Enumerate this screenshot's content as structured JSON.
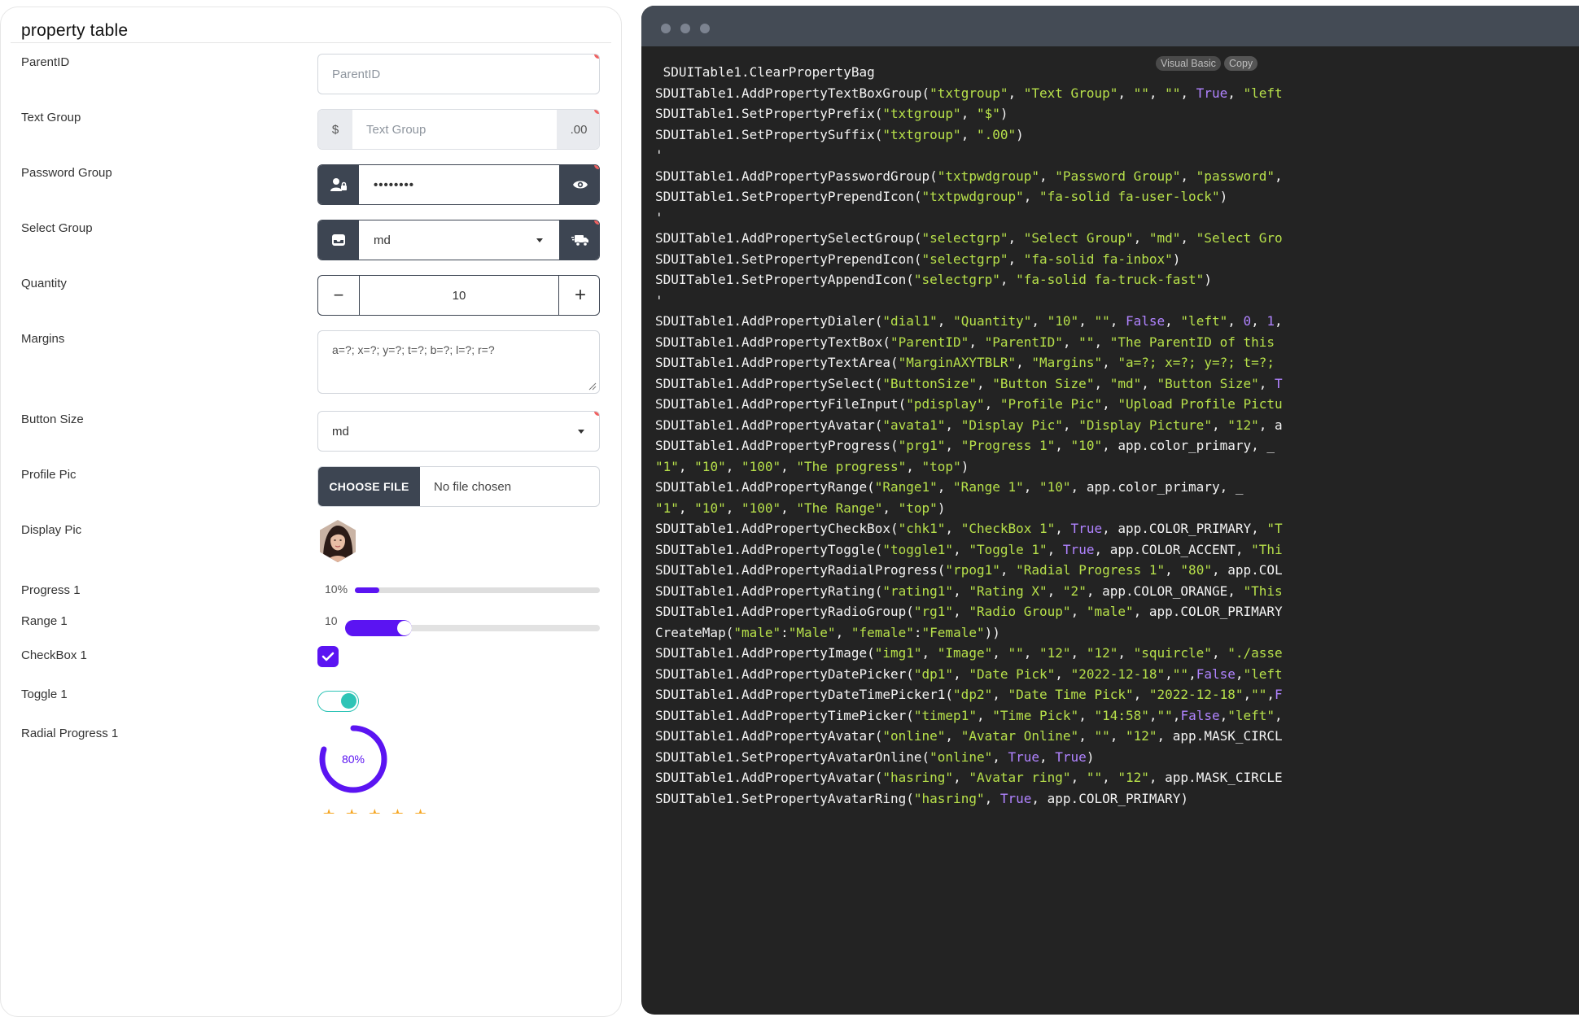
{
  "title": "property table",
  "fields": {
    "parentid": {
      "label": "ParentID",
      "placeholder": "ParentID"
    },
    "text_group": {
      "label": "Text Group",
      "prefix": "$",
      "placeholder": "Text Group",
      "suffix": ".00"
    },
    "password_group": {
      "label": "Password Group",
      "value": "••••••••",
      "prepend_icon": "user-lock-icon",
      "append_icon": "eye-icon"
    },
    "select_group": {
      "label": "Select Group",
      "value": "md",
      "prepend_icon": "inbox-icon",
      "append_icon": "truck-fast-icon"
    },
    "quantity": {
      "label": "Quantity",
      "value": "10",
      "minus": "−",
      "plus": "+"
    },
    "margins": {
      "label": "Margins",
      "value": "a=?; x=?; y=?; t=?; b=?; l=?; r=?"
    },
    "button_size": {
      "label": "Button Size",
      "value": "md"
    },
    "profile_pic": {
      "label": "Profile Pic",
      "button": "CHOOSE FILE",
      "status": "No file chosen"
    },
    "display_pic": {
      "label": "Display Pic",
      "avatar": "avatar-icon"
    },
    "progress": {
      "label": "Progress 1",
      "percent_text": "10%",
      "value": 10
    },
    "range": {
      "label": "Range 1",
      "value_text": "10",
      "value": 10,
      "min": 1,
      "max": 100
    },
    "checkbox": {
      "label": "CheckBox 1",
      "checked": true
    },
    "toggle": {
      "label": "Toggle 1",
      "on": true
    },
    "radial": {
      "label": "Radial Progress 1",
      "text": "80%",
      "value": 80
    }
  },
  "colors": {
    "primary": "#5b14f2",
    "accent": "#2ec4b6",
    "required_dot": "#ef6161",
    "dark_addon": "#3d4552",
    "star": "#f5a623"
  },
  "code_panel": {
    "language": "Visual Basic",
    "copy": "Copy",
    "lines": [
      [
        {
          "t": " SDUITable1.ClearPropertyBag"
        }
      ],
      [
        {
          "t": "SDUITable1.AddPropertyTextBoxGroup("
        },
        {
          "t": "\"txtgroup\"",
          "c": "s"
        },
        {
          "t": ", "
        },
        {
          "t": "\"Text Group\"",
          "c": "s"
        },
        {
          "t": ", "
        },
        {
          "t": "\"\"",
          "c": "s"
        },
        {
          "t": ", "
        },
        {
          "t": "\"\"",
          "c": "s"
        },
        {
          "t": ", "
        },
        {
          "t": "True",
          "c": "k"
        },
        {
          "t": ", "
        },
        {
          "t": "\"left",
          "c": "s"
        }
      ],
      [
        {
          "t": "SDUITable1.SetPropertyPrefix("
        },
        {
          "t": "\"txtgroup\"",
          "c": "s"
        },
        {
          "t": ", "
        },
        {
          "t": "\"$\"",
          "c": "s"
        },
        {
          "t": ")"
        }
      ],
      [
        {
          "t": "SDUITable1.SetPropertySuffix("
        },
        {
          "t": "\"txtgroup\"",
          "c": "s"
        },
        {
          "t": ", "
        },
        {
          "t": "\".00\"",
          "c": "s"
        },
        {
          "t": ")"
        }
      ],
      [
        {
          "t": "'"
        }
      ],
      [
        {
          "t": "SDUITable1.AddPropertyPasswordGroup("
        },
        {
          "t": "\"txtpwdgroup\"",
          "c": "s"
        },
        {
          "t": ", "
        },
        {
          "t": "\"Password Group\"",
          "c": "s"
        },
        {
          "t": ", "
        },
        {
          "t": "\"password\"",
          "c": "s"
        },
        {
          "t": ","
        }
      ],
      [
        {
          "t": "SDUITable1.SetPropertyPrependIcon("
        },
        {
          "t": "\"txtpwdgroup\"",
          "c": "s"
        },
        {
          "t": ", "
        },
        {
          "t": "\"fa-solid fa-user-lock\"",
          "c": "s"
        },
        {
          "t": ")"
        }
      ],
      [
        {
          "t": "'"
        }
      ],
      [
        {
          "t": "SDUITable1.AddPropertySelectGroup("
        },
        {
          "t": "\"selectgrp\"",
          "c": "s"
        },
        {
          "t": ", "
        },
        {
          "t": "\"Select Group\"",
          "c": "s"
        },
        {
          "t": ", "
        },
        {
          "t": "\"md\"",
          "c": "s"
        },
        {
          "t": ", "
        },
        {
          "t": "\"Select Gro",
          "c": "s"
        }
      ],
      [
        {
          "t": "SDUITable1.SetPropertyPrependIcon("
        },
        {
          "t": "\"selectgrp\"",
          "c": "s"
        },
        {
          "t": ", "
        },
        {
          "t": "\"fa-solid fa-inbox\"",
          "c": "s"
        },
        {
          "t": ")"
        }
      ],
      [
        {
          "t": "SDUITable1.SetPropertyAppendIcon("
        },
        {
          "t": "\"selectgrp\"",
          "c": "s"
        },
        {
          "t": ", "
        },
        {
          "t": "\"fa-solid fa-truck-fast\"",
          "c": "s"
        },
        {
          "t": ")"
        }
      ],
      [
        {
          "t": "'"
        }
      ],
      [
        {
          "t": "SDUITable1.AddPropertyDialer("
        },
        {
          "t": "\"dial1\"",
          "c": "s"
        },
        {
          "t": ", "
        },
        {
          "t": "\"Quantity\"",
          "c": "s"
        },
        {
          "t": ", "
        },
        {
          "t": "\"10\"",
          "c": "s"
        },
        {
          "t": ", "
        },
        {
          "t": "\"\"",
          "c": "s"
        },
        {
          "t": ", "
        },
        {
          "t": "False",
          "c": "k"
        },
        {
          "t": ", "
        },
        {
          "t": "\"left\"",
          "c": "s"
        },
        {
          "t": ", "
        },
        {
          "t": "0",
          "c": "k"
        },
        {
          "t": ", "
        },
        {
          "t": "1",
          "c": "k"
        },
        {
          "t": ","
        }
      ],
      [
        {
          "t": "SDUITable1.AddPropertyTextBox("
        },
        {
          "t": "\"ParentID\"",
          "c": "s"
        },
        {
          "t": ", "
        },
        {
          "t": "\"ParentID\"",
          "c": "s"
        },
        {
          "t": ", "
        },
        {
          "t": "\"\"",
          "c": "s"
        },
        {
          "t": ", "
        },
        {
          "t": "\"The ParentID of this",
          "c": "s"
        }
      ],
      [
        {
          "t": "SDUITable1.AddPropertyTextArea("
        },
        {
          "t": "\"MarginAXYTBLR\"",
          "c": "s"
        },
        {
          "t": ", "
        },
        {
          "t": "\"Margins\"",
          "c": "s"
        },
        {
          "t": ", "
        },
        {
          "t": "\"a=?; x=?; y=?; t=?;",
          "c": "s"
        }
      ],
      [
        {
          "t": "SDUITable1.AddPropertySelect("
        },
        {
          "t": "\"ButtonSize\"",
          "c": "s"
        },
        {
          "t": ", "
        },
        {
          "t": "\"Button Size\"",
          "c": "s"
        },
        {
          "t": ", "
        },
        {
          "t": "\"md\"",
          "c": "s"
        },
        {
          "t": ", "
        },
        {
          "t": "\"Button Size\"",
          "c": "s"
        },
        {
          "t": ", "
        },
        {
          "t": "T",
          "c": "k"
        }
      ],
      [
        {
          "t": "SDUITable1.AddPropertyFileInput("
        },
        {
          "t": "\"pdisplay\"",
          "c": "s"
        },
        {
          "t": ", "
        },
        {
          "t": "\"Profile Pic\"",
          "c": "s"
        },
        {
          "t": ", "
        },
        {
          "t": "\"Upload Profile Pictu",
          "c": "s"
        }
      ],
      [
        {
          "t": "SDUITable1.AddPropertyAvatar("
        },
        {
          "t": "\"avata1\"",
          "c": "s"
        },
        {
          "t": ", "
        },
        {
          "t": "\"Display Pic\"",
          "c": "s"
        },
        {
          "t": ", "
        },
        {
          "t": "\"Display Picture\"",
          "c": "s"
        },
        {
          "t": ", "
        },
        {
          "t": "\"12\"",
          "c": "s"
        },
        {
          "t": ", a"
        }
      ],
      [
        {
          "t": "SDUITable1.AddPropertyProgress("
        },
        {
          "t": "\"prg1\"",
          "c": "s"
        },
        {
          "t": ", "
        },
        {
          "t": "\"Progress 1\"",
          "c": "s"
        },
        {
          "t": ", "
        },
        {
          "t": "\"10\"",
          "c": "s"
        },
        {
          "t": ", app.color_primary, _"
        }
      ],
      [
        {
          "t": "\"1\"",
          "c": "s"
        },
        {
          "t": ", "
        },
        {
          "t": "\"10\"",
          "c": "s"
        },
        {
          "t": ", "
        },
        {
          "t": "\"100\"",
          "c": "s"
        },
        {
          "t": ", "
        },
        {
          "t": "\"The progress\"",
          "c": "s"
        },
        {
          "t": ", "
        },
        {
          "t": "\"top\"",
          "c": "s"
        },
        {
          "t": ")"
        }
      ],
      [
        {
          "t": "SDUITable1.AddPropertyRange("
        },
        {
          "t": "\"Range1\"",
          "c": "s"
        },
        {
          "t": ", "
        },
        {
          "t": "\"Range 1\"",
          "c": "s"
        },
        {
          "t": ", "
        },
        {
          "t": "\"10\"",
          "c": "s"
        },
        {
          "t": ", app.color_primary, _"
        }
      ],
      [
        {
          "t": "\"1\"",
          "c": "s"
        },
        {
          "t": ", "
        },
        {
          "t": "\"10\"",
          "c": "s"
        },
        {
          "t": ", "
        },
        {
          "t": "\"100\"",
          "c": "s"
        },
        {
          "t": ", "
        },
        {
          "t": "\"The Range\"",
          "c": "s"
        },
        {
          "t": ", "
        },
        {
          "t": "\"top\"",
          "c": "s"
        },
        {
          "t": ")"
        }
      ],
      [
        {
          "t": "SDUITable1.AddPropertyCheckBox("
        },
        {
          "t": "\"chk1\"",
          "c": "s"
        },
        {
          "t": ", "
        },
        {
          "t": "\"CheckBox 1\"",
          "c": "s"
        },
        {
          "t": ", "
        },
        {
          "t": "True",
          "c": "k"
        },
        {
          "t": ", app.COLOR_PRIMARY, "
        },
        {
          "t": "\"T",
          "c": "s"
        }
      ],
      [
        {
          "t": "SDUITable1.AddPropertyToggle("
        },
        {
          "t": "\"toggle1\"",
          "c": "s"
        },
        {
          "t": ", "
        },
        {
          "t": "\"Toggle 1\"",
          "c": "s"
        },
        {
          "t": ", "
        },
        {
          "t": "True",
          "c": "k"
        },
        {
          "t": ", app.COLOR_ACCENT, "
        },
        {
          "t": "\"Thi",
          "c": "s"
        }
      ],
      [
        {
          "t": "SDUITable1.AddPropertyRadialProgress("
        },
        {
          "t": "\"rpog1\"",
          "c": "s"
        },
        {
          "t": ", "
        },
        {
          "t": "\"Radial Progress 1\"",
          "c": "s"
        },
        {
          "t": ", "
        },
        {
          "t": "\"80\"",
          "c": "s"
        },
        {
          "t": ", app.COL"
        }
      ],
      [
        {
          "t": "SDUITable1.AddPropertyRating("
        },
        {
          "t": "\"rating1\"",
          "c": "s"
        },
        {
          "t": ", "
        },
        {
          "t": "\"Rating X\"",
          "c": "s"
        },
        {
          "t": ", "
        },
        {
          "t": "\"2\"",
          "c": "s"
        },
        {
          "t": ", app.COLOR_ORANGE, "
        },
        {
          "t": "\"This",
          "c": "s"
        }
      ],
      [
        {
          "t": "SDUITable1.AddPropertyRadioGroup("
        },
        {
          "t": "\"rg1\"",
          "c": "s"
        },
        {
          "t": ", "
        },
        {
          "t": "\"Radio Group\"",
          "c": "s"
        },
        {
          "t": ", "
        },
        {
          "t": "\"male\"",
          "c": "s"
        },
        {
          "t": ", app.COLOR_PRIMARY"
        }
      ],
      [
        {
          "t": "CreateMap("
        },
        {
          "t": "\"male\"",
          "c": "s"
        },
        {
          "t": ":"
        },
        {
          "t": "\"Male\"",
          "c": "s"
        },
        {
          "t": ", "
        },
        {
          "t": "\"female\"",
          "c": "s"
        },
        {
          "t": ":"
        },
        {
          "t": "\"Female\"",
          "c": "s"
        },
        {
          "t": "))"
        }
      ],
      [
        {
          "t": "SDUITable1.AddPropertyImage("
        },
        {
          "t": "\"img1\"",
          "c": "s"
        },
        {
          "t": ", "
        },
        {
          "t": "\"Image\"",
          "c": "s"
        },
        {
          "t": ", "
        },
        {
          "t": "\"\"",
          "c": "s"
        },
        {
          "t": ", "
        },
        {
          "t": "\"12\"",
          "c": "s"
        },
        {
          "t": ", "
        },
        {
          "t": "\"12\"",
          "c": "s"
        },
        {
          "t": ", "
        },
        {
          "t": "\"squircle\"",
          "c": "s"
        },
        {
          "t": ", "
        },
        {
          "t": "\"./asse",
          "c": "s"
        }
      ],
      [
        {
          "t": "SDUITable1.AddPropertyDatePicker("
        },
        {
          "t": "\"dp1\"",
          "c": "s"
        },
        {
          "t": ", "
        },
        {
          "t": "\"Date Pick\"",
          "c": "s"
        },
        {
          "t": ", "
        },
        {
          "t": "\"2022-12-18\"",
          "c": "s"
        },
        {
          "t": ","
        },
        {
          "t": "\"\"",
          "c": "s"
        },
        {
          "t": ","
        },
        {
          "t": "False",
          "c": "k"
        },
        {
          "t": ","
        },
        {
          "t": "\"left",
          "c": "s"
        }
      ],
      [
        {
          "t": "SDUITable1.AddPropertyDateTimePicker1("
        },
        {
          "t": "\"dp2\"",
          "c": "s"
        },
        {
          "t": ", "
        },
        {
          "t": "\"Date Time Pick\"",
          "c": "s"
        },
        {
          "t": ", "
        },
        {
          "t": "\"2022-12-18\"",
          "c": "s"
        },
        {
          "t": ","
        },
        {
          "t": "\"\"",
          "c": "s"
        },
        {
          "t": ","
        },
        {
          "t": "F",
          "c": "k"
        }
      ],
      [
        {
          "t": "SDUITable1.AddPropertyTimePicker("
        },
        {
          "t": "\"timep1\"",
          "c": "s"
        },
        {
          "t": ", "
        },
        {
          "t": "\"Time Pick\"",
          "c": "s"
        },
        {
          "t": ", "
        },
        {
          "t": "\"14:58\"",
          "c": "s"
        },
        {
          "t": ","
        },
        {
          "t": "\"\"",
          "c": "s"
        },
        {
          "t": ","
        },
        {
          "t": "False",
          "c": "k"
        },
        {
          "t": ","
        },
        {
          "t": "\"left\"",
          "c": "s"
        },
        {
          "t": ","
        }
      ],
      [
        {
          "t": "SDUITable1.AddPropertyAvatar("
        },
        {
          "t": "\"online\"",
          "c": "s"
        },
        {
          "t": ", "
        },
        {
          "t": "\"Avatar Online\"",
          "c": "s"
        },
        {
          "t": ", "
        },
        {
          "t": "\"\"",
          "c": "s"
        },
        {
          "t": ", "
        },
        {
          "t": "\"12\"",
          "c": "s"
        },
        {
          "t": ", app.MASK_CIRCL"
        }
      ],
      [
        {
          "t": "SDUITable1.SetPropertyAvatarOnline("
        },
        {
          "t": "\"online\"",
          "c": "s"
        },
        {
          "t": ", "
        },
        {
          "t": "True",
          "c": "k"
        },
        {
          "t": ", "
        },
        {
          "t": "True",
          "c": "k"
        },
        {
          "t": ")"
        }
      ],
      [
        {
          "t": "SDUITable1.AddPropertyAvatar("
        },
        {
          "t": "\"hasring\"",
          "c": "s"
        },
        {
          "t": ", "
        },
        {
          "t": "\"Avatar ring\"",
          "c": "s"
        },
        {
          "t": ", "
        },
        {
          "t": "\"\"",
          "c": "s"
        },
        {
          "t": ", "
        },
        {
          "t": "\"12\"",
          "c": "s"
        },
        {
          "t": ", app.MASK_CIRCLE"
        }
      ],
      [
        {
          "t": "SDUITable1.SetPropertyAvatarRing("
        },
        {
          "t": "\"hasring\"",
          "c": "s"
        },
        {
          "t": ", "
        },
        {
          "t": "True",
          "c": "k"
        },
        {
          "t": ", app.COLOR_PRIMARY)"
        }
      ]
    ]
  }
}
